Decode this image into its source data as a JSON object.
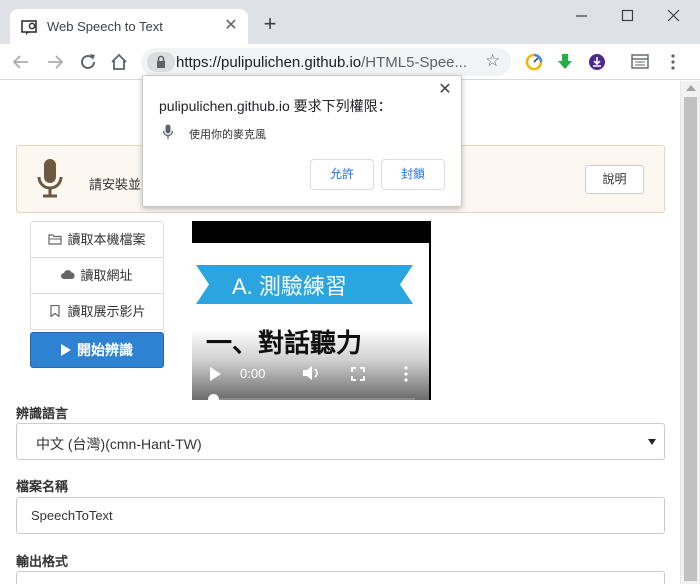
{
  "browser": {
    "tab_title": "Web Speech to Text",
    "new_tab_label": "+",
    "url_host": "https://pulipulichen.github.io",
    "url_rest": "/HTML5-Spee..."
  },
  "page": {
    "title_visible_fragment": ":",
    "notice_text": "請安裝並",
    "help_label": "說明",
    "side_buttons": {
      "read_local": "讀取本機檔案",
      "read_url": "讀取網址",
      "read_demo": "讀取展示影片"
    },
    "start_label": "開始辨識",
    "video": {
      "banner_text": "A. 測驗練習",
      "subtitle_text": "一、對話聽力",
      "time": "0:00",
      "progress": 0.0
    },
    "lang_label": "辨識語言",
    "lang_value": "中文 (台灣)(cmn-Hant-TW)",
    "file_label": "檔案名稱",
    "file_value": "SpeechToText",
    "output_label": "輸出格式"
  },
  "permission": {
    "title": "pulipulichen.github.io 要求下列權限：",
    "item": "使用你的麥克風",
    "allow_label": "允許",
    "block_label": "封鎖"
  },
  "colors": {
    "primary": "#2d83d1",
    "banner": "#2aa5e0",
    "notice_bg": "#fcf8f1",
    "link_blue": "#1a73e8"
  }
}
